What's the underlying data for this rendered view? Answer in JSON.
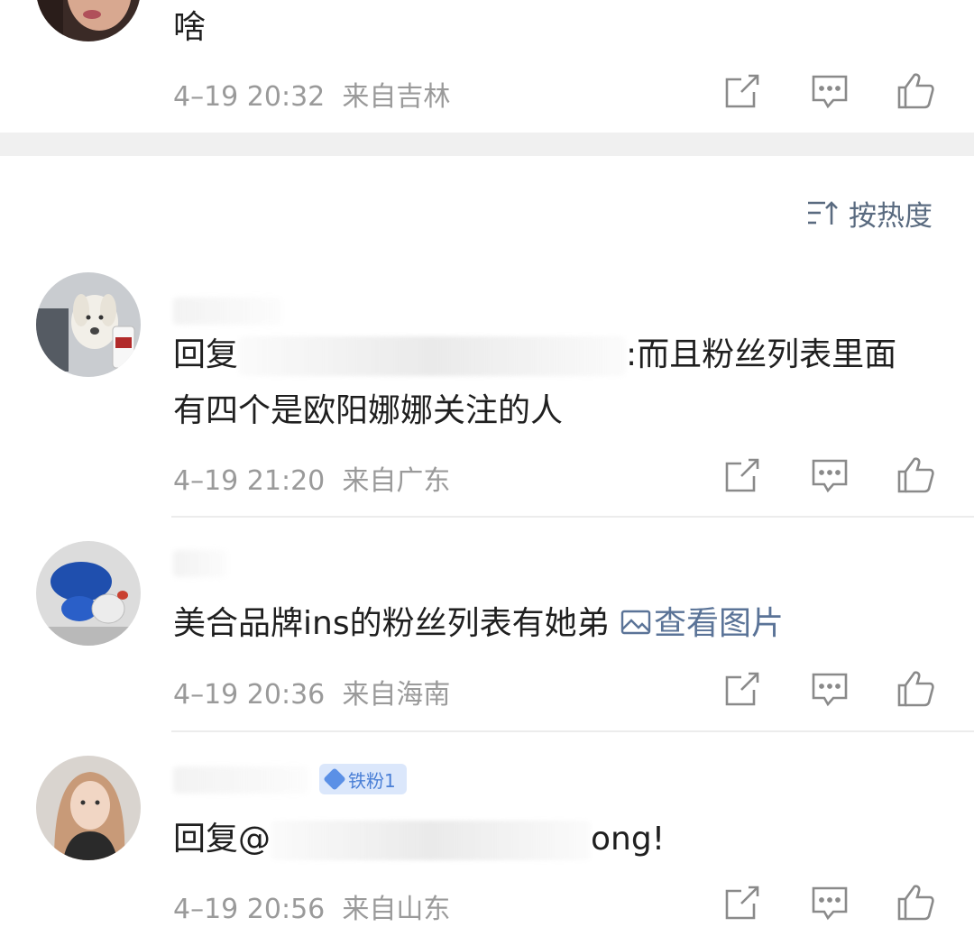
{
  "comments": [
    {
      "text": "啥",
      "time": "4–19 20:32",
      "location": "来自吉林"
    },
    {
      "text_prefix": "回复",
      "text_suffix": ":而且粉丝列表里面",
      "text_line2": "有四个是欧阳娜娜关注的人",
      "time": "4–19 21:20",
      "location": "来自广东"
    },
    {
      "text": "美合品牌ins的粉丝列表有她弟",
      "image_link": "查看图片",
      "time": "4–19 20:36",
      "location": "来自海南"
    },
    {
      "badge": "铁粉1",
      "text_prefix": "回复@",
      "text_suffix": "ong!",
      "time": "4–19 20:56",
      "location": "来自山东"
    }
  ],
  "sort": {
    "label": "按热度"
  },
  "icons": {
    "share": "share-icon",
    "reply": "comment-icon",
    "like": "thumbs-up-icon",
    "sort": "sort-icon",
    "image": "image-icon"
  },
  "colors": {
    "meta": "#9a9a9a",
    "link": "#5a7397",
    "badge_bg": "#dbe7fb",
    "badge_text": "#4a7fd6"
  }
}
